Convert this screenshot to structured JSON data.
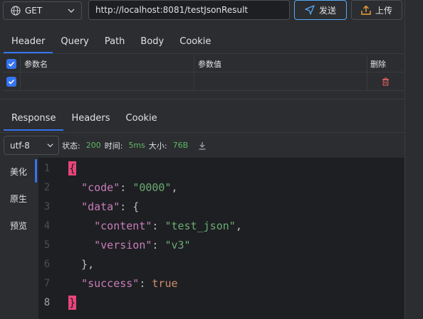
{
  "toolbar": {
    "method": "GET",
    "url": "http://localhost:8081/testJsonResult",
    "send_label": "发送",
    "upload_label": "上传"
  },
  "request_tabs": [
    "Header",
    "Query",
    "Path",
    "Body",
    "Cookie"
  ],
  "header_table": {
    "columns": [
      "参数名",
      "参数值",
      "删除"
    ],
    "rows": [
      {
        "name": "",
        "value": ""
      }
    ]
  },
  "response_tabs": [
    "Response",
    "Headers",
    "Cookie"
  ],
  "status": {
    "encoding": "utf-8",
    "status_label": "状态:",
    "status_value": "200",
    "time_label": "时间:",
    "time_value": "5ms",
    "size_label": "大小:",
    "size_value": "76B"
  },
  "view_tabs": [
    "美化",
    "原生",
    "预览"
  ],
  "code_lines": [
    {
      "num": "1",
      "text": "{"
    },
    {
      "num": "2",
      "text": "  \"code\": \"0000\","
    },
    {
      "num": "3",
      "text": "  \"data\": {"
    },
    {
      "num": "4",
      "text": "    \"content\": \"test_json\","
    },
    {
      "num": "5",
      "text": "    \"version\": \"v3\""
    },
    {
      "num": "6",
      "text": "  },"
    },
    {
      "num": "7",
      "text": "  \"success\": true"
    },
    {
      "num": "8",
      "text": "}"
    }
  ],
  "colors": {
    "accent": "#3574f0",
    "status_green": "#5fb865",
    "brace_highlight": "#e8457c"
  }
}
